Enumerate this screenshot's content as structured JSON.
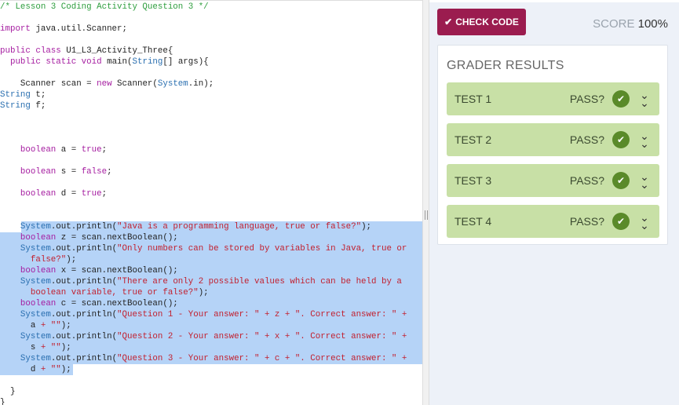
{
  "editor": {
    "lines": [
      [
        [
          "c",
          "/* Lesson 3 Coding Activity Question 3 */"
        ]
      ],
      [],
      [
        [
          "k",
          "import"
        ],
        [
          "p",
          " java.util.Scanner;"
        ]
      ],
      [],
      [
        [
          "k",
          "public class"
        ],
        [
          "p",
          " U1_L3_Activity_Three{"
        ]
      ],
      [
        [
          "p",
          "  "
        ],
        [
          "k",
          "public static void"
        ],
        [
          "p",
          " main("
        ],
        [
          "t",
          "String"
        ],
        [
          "p",
          "[] args){"
        ]
      ],
      [],
      [
        [
          "p",
          "    Scanner scan = "
        ],
        [
          "k",
          "new"
        ],
        [
          "p",
          " Scanner("
        ],
        [
          "t",
          "System"
        ],
        [
          "p",
          ".in);"
        ]
      ],
      [
        [
          "t",
          "String"
        ],
        [
          "p",
          " t;"
        ]
      ],
      [
        [
          "t",
          "String"
        ],
        [
          "p",
          " f;"
        ]
      ],
      [],
      [],
      [],
      [
        [
          "p",
          "    "
        ],
        [
          "k",
          "boolean"
        ],
        [
          "p",
          " a = "
        ],
        [
          "k",
          "true"
        ],
        [
          "p",
          ";"
        ]
      ],
      [],
      [
        [
          "p",
          "    "
        ],
        [
          "k",
          "boolean"
        ],
        [
          "p",
          " s = "
        ],
        [
          "k",
          "false"
        ],
        [
          "p",
          ";"
        ]
      ],
      [],
      [
        [
          "p",
          "    "
        ],
        [
          "k",
          "boolean"
        ],
        [
          "p",
          " d = "
        ],
        [
          "k",
          "true"
        ],
        [
          "p",
          ";"
        ]
      ],
      [],
      [],
      [
        [
          "p",
          "    "
        ],
        [
          "t",
          "System"
        ],
        [
          "p",
          ".out.println("
        ],
        [
          "s",
          "\"Java is a programming language, true or false?\""
        ],
        [
          "p",
          ");"
        ]
      ],
      [
        [
          "p",
          "    "
        ],
        [
          "k",
          "boolean"
        ],
        [
          "p",
          " z = scan.nextBoolean();"
        ]
      ],
      [
        [
          "p",
          "    "
        ],
        [
          "t",
          "System"
        ],
        [
          "p",
          ".out.println("
        ],
        [
          "s",
          "\"Only numbers can be stored by variables in Java, true or"
        ]
      ],
      [
        [
          "s",
          "      false?\""
        ],
        [
          "p",
          ");"
        ]
      ],
      [
        [
          "p",
          "    "
        ],
        [
          "k",
          "boolean"
        ],
        [
          "p",
          " x = scan.nextBoolean();"
        ]
      ],
      [
        [
          "p",
          "    "
        ],
        [
          "t",
          "System"
        ],
        [
          "p",
          ".out.println("
        ],
        [
          "s",
          "\"There are only 2 possible values which can be held by a"
        ]
      ],
      [
        [
          "s",
          "      boolean variable, true or false?\""
        ],
        [
          "p",
          ");"
        ]
      ],
      [
        [
          "p",
          "    "
        ],
        [
          "k",
          "boolean"
        ],
        [
          "p",
          " c = scan.nextBoolean();"
        ]
      ],
      [
        [
          "p",
          "    "
        ],
        [
          "t",
          "System"
        ],
        [
          "p",
          ".out.println("
        ],
        [
          "s",
          "\"Question 1 - Your answer: \" + z + \". Correct answer: \" +"
        ]
      ],
      [
        [
          "p",
          "      a "
        ],
        [
          "s",
          "+ \"\""
        ],
        [
          "p",
          ");"
        ]
      ],
      [
        [
          "p",
          "    "
        ],
        [
          "t",
          "System"
        ],
        [
          "p",
          ".out.println("
        ],
        [
          "s",
          "\"Question 2 - Your answer: \" + x + \". Correct answer: \" +"
        ]
      ],
      [
        [
          "p",
          "      s "
        ],
        [
          "s",
          "+ \"\""
        ],
        [
          "p",
          ");"
        ]
      ],
      [
        [
          "p",
          "    "
        ],
        [
          "t",
          "System"
        ],
        [
          "p",
          ".out.println("
        ],
        [
          "s",
          "\"Question 3 - Your answer: \" + c + \". Correct answer: \" +"
        ]
      ],
      [
        [
          "p",
          "      d "
        ],
        [
          "s",
          "+ \"\""
        ],
        [
          "p",
          ");"
        ]
      ],
      [],
      [
        [
          "p",
          "  }"
        ]
      ],
      [
        [
          "p",
          "}"
        ]
      ]
    ],
    "selection": {
      "from": 20,
      "to": 33
    }
  },
  "toolbar": {
    "check_label": "CHECK CODE",
    "check_icon": "checkmark-icon",
    "score_label": "SCORE",
    "score_value": "100%"
  },
  "grader": {
    "title": "GRADER RESULTS",
    "tests": [
      {
        "name": "TEST 1",
        "pass_label": "PASS?",
        "passed": true
      },
      {
        "name": "TEST 2",
        "pass_label": "PASS?",
        "passed": true
      },
      {
        "name": "TEST 3",
        "pass_label": "PASS?",
        "passed": true
      },
      {
        "name": "TEST 4",
        "pass_label": "PASS?",
        "passed": true
      }
    ]
  },
  "colors": {
    "accent": "#9b1c4f",
    "pass_bg": "#c8e0a6",
    "pass_icon": "#5a8a2a",
    "selection": "#b5d3f7"
  }
}
